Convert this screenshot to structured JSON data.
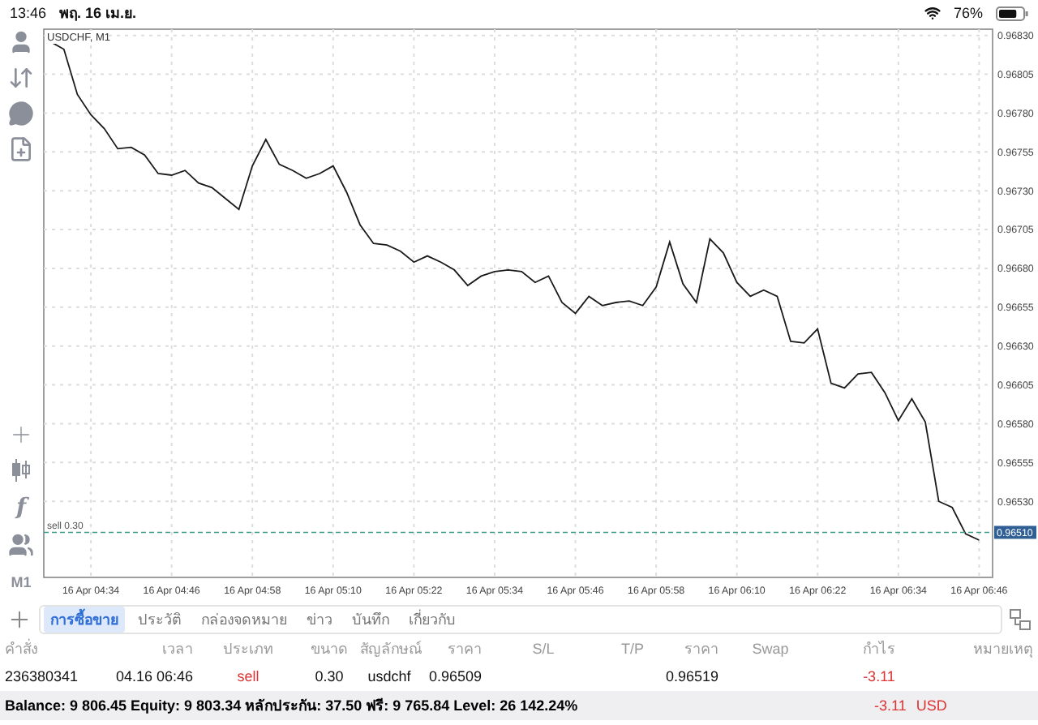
{
  "status_bar": {
    "time": "13:46",
    "date": "พฤ. 16 เม.ย.",
    "battery": "76%"
  },
  "toolbar": {
    "top": [
      {
        "kind": "icon"
      },
      {
        "kind": "icon"
      },
      {
        "kind": "icon"
      },
      {
        "kind": "icon"
      }
    ],
    "bottom": [
      {
        "kind": "icon"
      },
      {
        "kind": "icon"
      },
      {
        "kind": "text",
        "label": "f"
      },
      {
        "kind": "icon"
      },
      {
        "kind": "text",
        "label": "M1"
      }
    ]
  },
  "chart": {
    "title": "USDCHF, M1",
    "current_price": "0.96510",
    "chart_data": {
      "type": "line",
      "ylim": [
        0.96481,
        0.96834
      ],
      "categories": [
        null,
        null,
        null,
        "16 Apr 04:34",
        null,
        null,
        null,
        null,
        null,
        "16 Apr 04:46",
        null,
        null,
        null,
        null,
        null,
        "16 Apr 04:58",
        null,
        null,
        null,
        null,
        null,
        "16 Apr 05:10",
        null,
        null,
        null,
        null,
        null,
        "16 Apr 05:22",
        null,
        null,
        null,
        null,
        null,
        "16 Apr 05:34",
        null,
        null,
        null,
        null,
        null,
        "16 Apr 05:46",
        null,
        null,
        null,
        null,
        null,
        "16 Apr 05:58",
        null,
        null,
        null,
        null,
        null,
        "16 Apr 06:10",
        null,
        null,
        null,
        null,
        null,
        "16 Apr 06:22",
        null,
        null,
        null,
        null,
        null,
        "16 Apr 06:34",
        null,
        null,
        null,
        null,
        null,
        "16 Apr 06:46"
      ],
      "yticks": [
        {
          "value": 0.9683,
          "label": "0.96830"
        },
        {
          "value": 0.96805,
          "label": "0.96805"
        },
        {
          "value": 0.9678,
          "label": "0.96780"
        },
        {
          "value": 0.96755,
          "label": "0.96755"
        },
        {
          "value": 0.9673,
          "label": "0.96730"
        },
        {
          "value": 0.96705,
          "label": "0.96705"
        },
        {
          "value": 0.9668,
          "label": "0.96680"
        },
        {
          "value": 0.96655,
          "label": "0.96655"
        },
        {
          "value": 0.9663,
          "label": "0.96630"
        },
        {
          "value": 0.96605,
          "label": "0.96605"
        },
        {
          "value": 0.9658,
          "label": "0.96580"
        },
        {
          "value": 0.96555,
          "label": "0.96555"
        },
        {
          "value": 0.9653,
          "label": "0.96530"
        }
      ],
      "grid": true,
      "ref_lines": [
        {
          "axis": "y",
          "label": "sell 0.30",
          "value": 0.9651,
          "color": "#3a9a8a"
        }
      ],
      "series": [
        {
          "color": "#1a1a1a",
          "values": [
            0.96826,
            0.96821,
            0.96792,
            0.96779,
            0.9677,
            0.96757,
            0.96758,
            0.96753,
            0.96741,
            0.9674,
            0.96743,
            0.96735,
            0.96732,
            0.96725,
            0.96718,
            0.96746,
            0.96763,
            0.96747,
            0.96743,
            0.96738,
            0.96741,
            0.96746,
            0.96729,
            0.96708,
            0.96696,
            0.96695,
            0.96691,
            0.96684,
            0.96688,
            0.96684,
            0.96679,
            0.96669,
            0.96675,
            0.96678,
            0.96679,
            0.96678,
            0.96671,
            0.96675,
            0.96658,
            0.96651,
            0.96662,
            0.96656,
            0.96658,
            0.96659,
            0.96656,
            0.96668,
            0.96697,
            0.9667,
            0.96658,
            0.96699,
            0.9669,
            0.96671,
            0.96662,
            0.96666,
            0.96662,
            0.96633,
            0.96632,
            0.96641,
            0.96606,
            0.96603,
            0.96612,
            0.96613,
            0.966,
            0.96582,
            0.96596,
            0.96581,
            0.9653,
            0.96526,
            0.96509,
            0.96505
          ]
        }
      ]
    }
  },
  "tabs": [
    {
      "label": "การซื้อขาย",
      "selected": true
    },
    {
      "label": "ประวัติ",
      "selected": false
    },
    {
      "label": "กล่องจดหมาย",
      "selected": false
    },
    {
      "label": "ข่าว",
      "selected": false
    },
    {
      "label": "บันทึก",
      "selected": false
    },
    {
      "label": "เกี่ยวกับ",
      "selected": false
    }
  ],
  "table": {
    "columns": [
      "คำสั่ง",
      "เวลา",
      "ประเภท",
      "ขนาด",
      "สัญลักษณ์",
      "ราคา",
      "S/L",
      "T/P",
      "ราคา",
      "Swap",
      "กำไร",
      "หมายเหตุ"
    ],
    "rows": [
      {
        "cells": [
          "236380341",
          "04.16 06:46",
          "sell",
          "0.30",
          "usdchf",
          "0.96509",
          "",
          "",
          "0.96519",
          "",
          "-3.11",
          ""
        ]
      }
    ]
  },
  "summary": {
    "text": "Balance: 9 806.45 Equity: 9 803.34 หลักประกัน: 37.50 ฟรี: 9 765.84 Level: 26 142.24%",
    "profit": "-3.11",
    "currency": "USD"
  }
}
